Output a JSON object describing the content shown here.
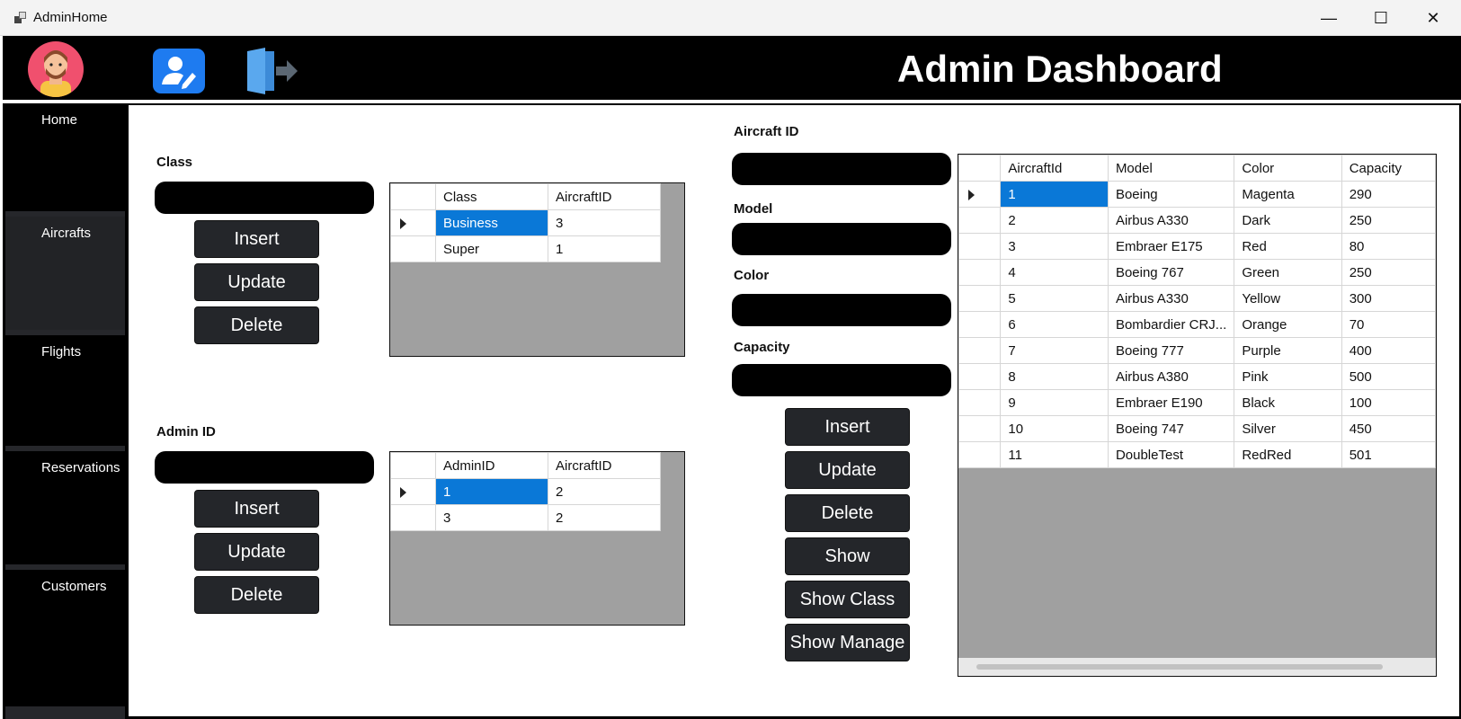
{
  "window": {
    "title": "AdminHome",
    "minimize": "—",
    "maximize": "☐",
    "close": "✕"
  },
  "header": {
    "title": "Admin Dashboard"
  },
  "sidebar": {
    "items": [
      {
        "label": "Home"
      },
      {
        "label": "Aircrafts"
      },
      {
        "label": "Flights"
      },
      {
        "label": "Reservations"
      },
      {
        "label": "Customers"
      }
    ]
  },
  "class_section": {
    "label": "Class",
    "input_value": "",
    "buttons": [
      "Insert",
      "Update",
      "Delete"
    ],
    "columns": [
      "Class",
      "AircraftID"
    ],
    "rows": [
      [
        "Business",
        "3"
      ],
      [
        "Super",
        "1"
      ]
    ]
  },
  "admin_section": {
    "label": "Admin ID",
    "input_value": "",
    "buttons": [
      "Insert",
      "Update",
      "Delete"
    ],
    "columns": [
      "AdminID",
      "AircraftID"
    ],
    "rows": [
      [
        "1",
        "2"
      ],
      [
        "3",
        "2"
      ]
    ]
  },
  "aircraft_form": {
    "fields": [
      {
        "label": "Aircraft ID",
        "value": ""
      },
      {
        "label": "Model",
        "value": ""
      },
      {
        "label": "Color",
        "value": ""
      },
      {
        "label": "Capacity",
        "value": ""
      }
    ],
    "buttons": [
      "Insert",
      "Update",
      "Delete",
      "Show",
      "Show Class",
      "Show Manage"
    ]
  },
  "aircraft_grid": {
    "columns": [
      "AircraftId",
      "Model",
      "Color",
      "Capacity"
    ],
    "rows": [
      [
        "1",
        "Boeing",
        "Magenta",
        "290"
      ],
      [
        "2",
        "Airbus A330",
        "Dark",
        "250"
      ],
      [
        "3",
        "Embraer E175",
        "Red",
        "80"
      ],
      [
        "4",
        "Boeing 767",
        "Green",
        "250"
      ],
      [
        "5",
        "Airbus A330",
        "Yellow",
        "300"
      ],
      [
        "6",
        "Bombardier CRJ...",
        "Orange",
        "70"
      ],
      [
        "7",
        "Boeing 777",
        "Purple",
        "400"
      ],
      [
        "8",
        "Airbus A380",
        "Pink",
        "500"
      ],
      [
        "9",
        "Embraer E190",
        "Black",
        "100"
      ],
      [
        "10",
        "Boeing 747",
        "Silver",
        "450"
      ],
      [
        "11",
        "DoubleTest",
        "RedRed",
        "501"
      ]
    ]
  },
  "colors": {
    "selection": "#0a78d7",
    "dark_button": "#24262a",
    "grid_empty": "#a0a0a0",
    "edit_icon_bg": "#1e7bf0",
    "avatar_bg": "#f0506e"
  },
  "icons": {
    "avatar": "user-avatar-icon",
    "edit_profile": "user-edit-icon",
    "logout": "logout-door-icon",
    "app": "app-window-icon"
  }
}
